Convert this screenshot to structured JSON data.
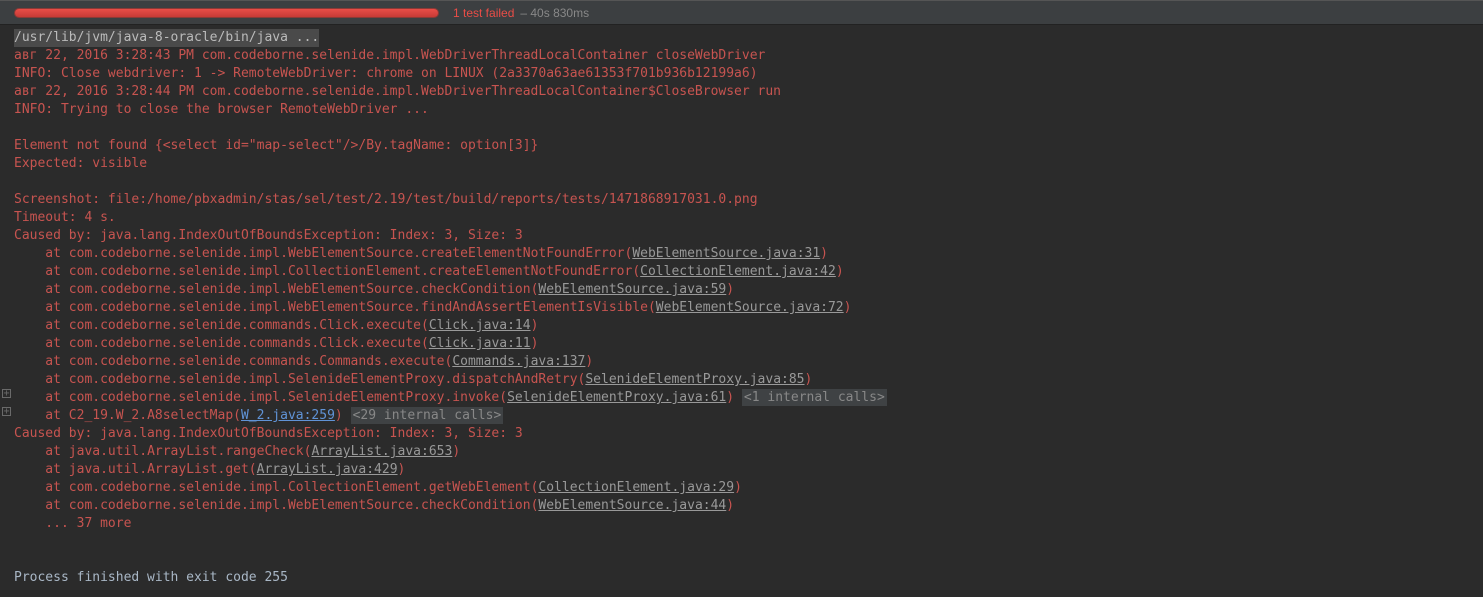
{
  "header": {
    "status": "1 test failed",
    "time": " – 40s 830ms"
  },
  "cmd": "/usr/lib/jvm/java-8-oracle/bin/java ...",
  "log1": "авг 22, 2016 3:28:43 PM com.codeborne.selenide.impl.WebDriverThreadLocalContainer closeWebDriver",
  "log2": "INFO: Close webdriver: 1 -> RemoteWebDriver: chrome on LINUX (2a3370a63ae61353f701b936b12199a6)",
  "log3": "авг 22, 2016 3:28:44 PM com.codeborne.selenide.impl.WebDriverThreadLocalContainer$CloseBrowser run",
  "log4": "INFO: Trying to close the browser RemoteWebDriver ...",
  "err1": "Element not found {<select id=\"map-select\"/>/By.tagName: option[3]}",
  "err2": "Expected: visible",
  "scr": "Screenshot: file:/home/pbxadmin/stas/sel/test/2.19/test/build/reports/tests/1471868917031.0.png",
  "timeout": "Timeout: 4 s.",
  "cause": "Caused by: java.lang.IndexOutOfBoundsException: Index: 3, Size: 3",
  "at": "    at ",
  "st": [
    {
      "m": "com.codeborne.selenide.impl.WebElementSource.createElementNotFoundError(",
      "l": "WebElementSource.java:31",
      "c": ")"
    },
    {
      "m": "com.codeborne.selenide.impl.CollectionElement.createElementNotFoundError(",
      "l": "CollectionElement.java:42",
      "c": ")"
    },
    {
      "m": "com.codeborne.selenide.impl.WebElementSource.checkCondition(",
      "l": "WebElementSource.java:59",
      "c": ")"
    },
    {
      "m": "com.codeborne.selenide.impl.WebElementSource.findAndAssertElementIsVisible(",
      "l": "WebElementSource.java:72",
      "c": ")"
    },
    {
      "m": "com.codeborne.selenide.commands.Click.execute(",
      "l": "Click.java:14",
      "c": ")"
    },
    {
      "m": "com.codeborne.selenide.commands.Click.execute(",
      "l": "Click.java:11",
      "c": ")"
    },
    {
      "m": "com.codeborne.selenide.commands.Commands.execute(",
      "l": "Commands.java:137",
      "c": ")"
    },
    {
      "m": "com.codeborne.selenide.impl.SelenideElementProxy.dispatchAndRetry(",
      "l": "SelenideElementProxy.java:85",
      "c": ")"
    }
  ],
  "st_int": {
    "m": "com.codeborne.selenide.impl.SelenideElementProxy.invoke(",
    "l": "SelenideElementProxy.java:61",
    "c": ")",
    "badge": "<1 internal calls>"
  },
  "st_user": {
    "m": "C2_19.W_2.A8selectMap(",
    "l": "W_2.java:259",
    "c": ")",
    "badge": "<29 internal calls>"
  },
  "cause2": "Caused by: java.lang.IndexOutOfBoundsException: Index: 3, Size: 3",
  "st2": [
    {
      "m": "java.util.ArrayList.rangeCheck(",
      "l": "ArrayList.java:653",
      "c": ")"
    },
    {
      "m": "java.util.ArrayList.get(",
      "l": "ArrayList.java:429",
      "c": ")"
    },
    {
      "m": "com.codeborne.selenide.impl.CollectionElement.getWebElement(",
      "l": "CollectionElement.java:29",
      "c": ")"
    },
    {
      "m": "com.codeborne.selenide.impl.WebElementSource.checkCondition(",
      "l": "WebElementSource.java:44",
      "c": ")"
    }
  ],
  "more": "    ... 37 more",
  "exit": "Process finished with exit code 255"
}
